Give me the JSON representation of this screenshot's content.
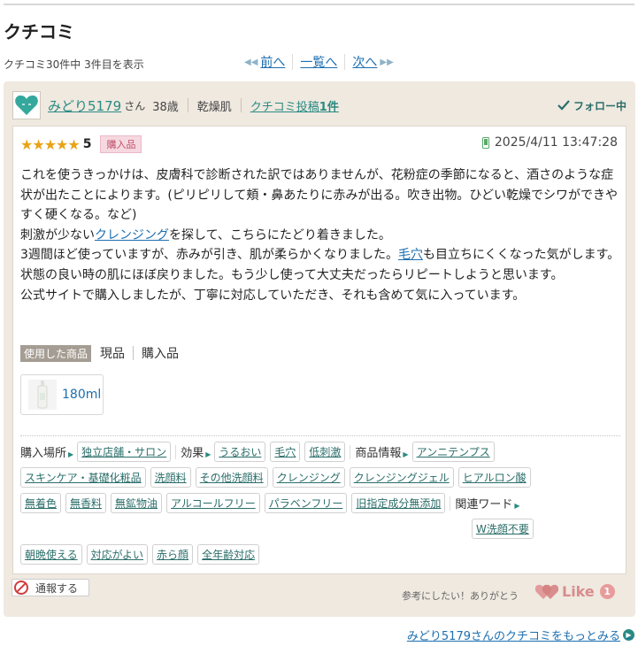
{
  "page": {
    "title": "クチコミ",
    "count_text": "クチコミ30件中 3件目を表示"
  },
  "pager": {
    "prev": "前へ",
    "list": "一覧へ",
    "next": "次へ"
  },
  "user": {
    "name": "みどり5179",
    "honorific": "さん",
    "age": "38歳",
    "skin_type": "乾燥肌",
    "post_prefix": "クチコミ投稿",
    "post_count": "1件",
    "follow_label": "フォロー中"
  },
  "review": {
    "stars": 5,
    "score": "5",
    "badge": "購入品",
    "date": "2025/4/11 13:47:28",
    "paragraphs": {
      "p1": "これを使うきっかけは、皮膚科で診断された訳ではありませんが、花粉症の季節になると、酒さのような症状が出たことによります。(ピリピリして頬・鼻あたりに赤みが出る。吹き出物。ひどい乾燥でシワができやすく硬くなる。など)",
      "p2_before": "刺激が少ない",
      "p2_link": "クレンジング",
      "p2_after": "を探して、こちらにたどり着きました。",
      "p3_before": "3週間ほど使っていますが、赤みが引き、肌が柔らかくなりました。",
      "p3_link": "毛穴",
      "p3_after": "も目立ちにくくなった気がします。状態の良い時の肌にほぼ戻りました。もう少し使って大丈夫だったらリピートしようと思います。",
      "p4": "公式サイトで購入しましたが、丁寧に対応していただき、それも含めて気に入っています。"
    },
    "used_label": "使用した商品",
    "used_status": "現品",
    "used_purchase": "購入品",
    "product_size": "180ml"
  },
  "tags": {
    "purchase_place_label": "購入場所",
    "purchase_place": [
      "独立店舗・サロン"
    ],
    "effect_label": "効果",
    "effects": [
      "うるおい",
      "毛穴",
      "低刺激"
    ],
    "product_info_label": "商品情報",
    "product_info_line1": [
      "アンニテンプス"
    ],
    "product_info_line2": [
      "スキンケア・基礎化粧品",
      "洗顔料",
      "その他洗顔料",
      "クレンジング",
      "クレンジングジェル",
      "ヒアルロン酸"
    ],
    "product_info_line3": [
      "無着色",
      "無香料",
      "無鉱物油",
      "アルコールフリー",
      "パラベンフリー",
      "旧指定成分無添加"
    ],
    "related_label": "関連ワード",
    "related_line1": [
      "W洗顔不要"
    ],
    "related_line2": [
      "朝晩使える",
      "対応がよい",
      "赤ら顔",
      "全年齢対応"
    ]
  },
  "footer": {
    "report_label": "通報する",
    "helpful_text": "参考にしたい！ありがとう",
    "like_label": "Like",
    "like_count": "1",
    "more_link": "みどり5179さんのクチコミをもっとみる"
  }
}
